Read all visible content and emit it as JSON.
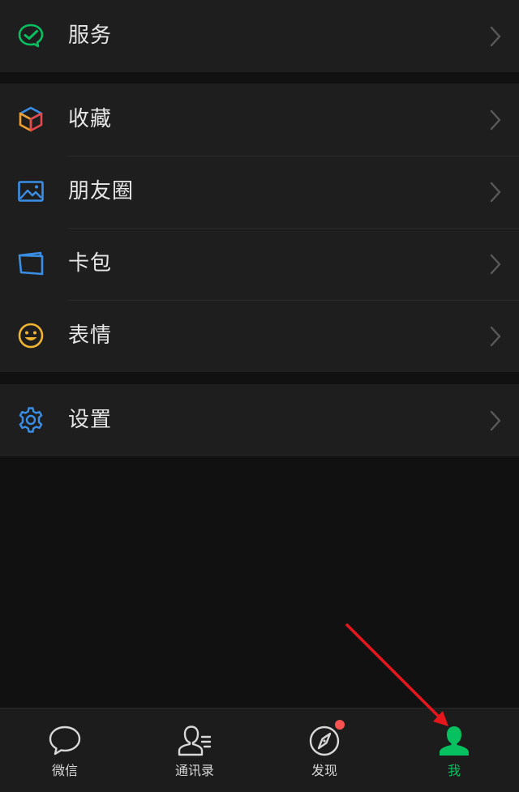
{
  "groups": [
    {
      "items": [
        {
          "key": "services",
          "label": "服务",
          "icon": "wechat-pay-check-icon",
          "color": "#07c160"
        }
      ]
    },
    {
      "items": [
        {
          "key": "favorites",
          "label": "收藏",
          "icon": "cube-icon",
          "color": "#f0a030"
        },
        {
          "key": "moments",
          "label": "朋友圈",
          "icon": "picture-icon",
          "color": "#3a8ee6"
        },
        {
          "key": "cards",
          "label": "卡包",
          "icon": "wallet-icon",
          "color": "#3a8ee6"
        },
        {
          "key": "stickers",
          "label": "表情",
          "icon": "smiley-icon",
          "color": "#f0b430"
        }
      ]
    },
    {
      "items": [
        {
          "key": "settings",
          "label": "设置",
          "icon": "gear-icon",
          "color": "#3a8ee6"
        }
      ]
    }
  ],
  "tabbar": {
    "tabs": [
      {
        "key": "chats",
        "label": "微信",
        "icon": "chat-bubble-icon",
        "active": false
      },
      {
        "key": "contacts",
        "label": "通讯录",
        "icon": "contacts-icon",
        "active": false
      },
      {
        "key": "discover",
        "label": "发现",
        "icon": "compass-icon",
        "active": false,
        "badge": "dot"
      },
      {
        "key": "me",
        "label": "我",
        "icon": "person-icon",
        "active": true
      }
    ],
    "active_color": "#07c160",
    "badge_color": "#fa5151"
  }
}
